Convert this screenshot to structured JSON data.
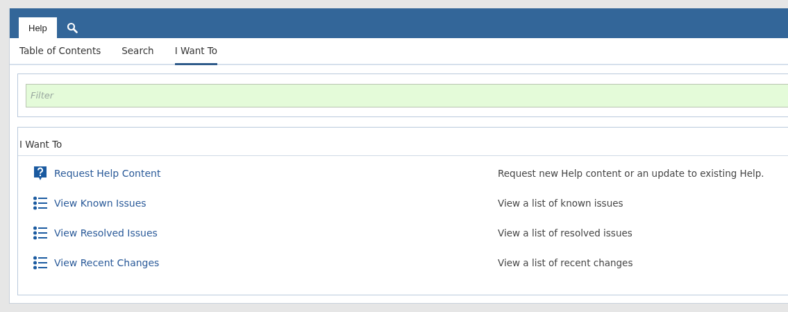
{
  "header_tabs": [
    {
      "kind": "text",
      "label": "Help",
      "selected": true
    },
    {
      "kind": "search",
      "selected": false
    }
  ],
  "subtabs": [
    {
      "label": "Table of Contents",
      "selected": false
    },
    {
      "label": "Search",
      "selected": false
    },
    {
      "label": "I Want To",
      "selected": true
    }
  ],
  "filter": {
    "placeholder": "Filter"
  },
  "panel": {
    "title": "I Want To",
    "items": [
      {
        "kind": "help",
        "label": "Request Help Content",
        "description": "Request new Help content or an update to existing Help."
      },
      {
        "kind": "list",
        "label": "View Known Issues",
        "description": "View a list of known issues"
      },
      {
        "kind": "list",
        "label": "View Resolved Issues",
        "description": "View a list of resolved issues"
      },
      {
        "kind": "list",
        "label": "View Recent Changes",
        "description": "View a list of recent changes"
      }
    ]
  }
}
